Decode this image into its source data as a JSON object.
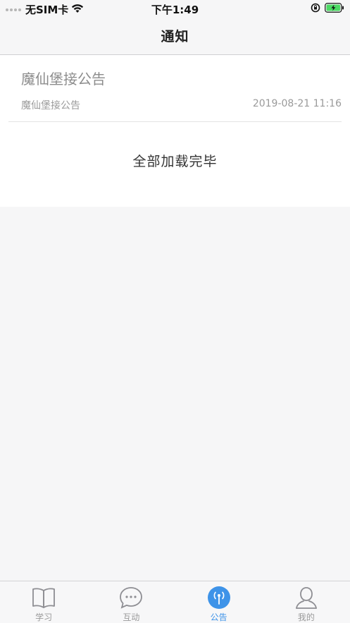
{
  "status_bar": {
    "carrier": "无SIM卡",
    "time": "下午1:49",
    "icons": [
      "signal-dots-icon",
      "wifi-icon",
      "orientation-lock-icon",
      "battery-charging-icon"
    ]
  },
  "nav": {
    "title": "通知"
  },
  "notices": [
    {
      "title": "魔仙堡接公告",
      "subtitle": "魔仙堡接公告",
      "date": "2019-08-21 11:16"
    }
  ],
  "footer_text": "全部加载完毕",
  "tabs": [
    {
      "label": "学习",
      "icon": "book-icon",
      "active": false
    },
    {
      "label": "互动",
      "icon": "chat-bubble-icon",
      "active": false
    },
    {
      "label": "公告",
      "icon": "broadcast-icon",
      "active": true
    },
    {
      "label": "我的",
      "icon": "person-icon",
      "active": false
    }
  ],
  "colors": {
    "accent": "#3e93e8",
    "background": "#f6f6f7",
    "battery": "#4cd964"
  }
}
